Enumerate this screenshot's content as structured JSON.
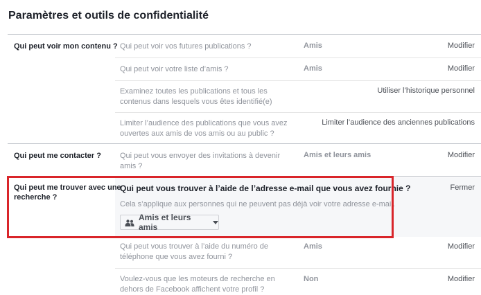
{
  "page_title": "Paramètres et outils de confidentialité",
  "sections": [
    {
      "label": "Qui peut voir mon contenu ?",
      "rows": [
        {
          "question": "Qui peut voir vos futures publications ?",
          "value": "Amis",
          "action": "Modifier"
        },
        {
          "question": "Qui peut voir votre liste d’amis ?",
          "value": "Amis",
          "action": "Modifier"
        },
        {
          "question_lines": [
            "Examinez toutes les publications et tous les",
            "contenus dans lesquels vous êtes identifié(e)"
          ],
          "value": "",
          "action": "Utiliser l’historique personnel"
        },
        {
          "question_lines": [
            "Limiter l’audience des publications que vous avez",
            "ouvertes aux amis de vos amis ou au public ?"
          ],
          "value": "",
          "action": "Limiter l’audience des anciennes publications"
        }
      ]
    },
    {
      "label": "Qui peut me contacter ?",
      "rows": [
        {
          "question_lines": [
            "Qui peut vous envoyer des invitations à devenir",
            "amis ?"
          ],
          "value": "Amis et leurs amis",
          "action": "Modifier"
        }
      ]
    },
    {
      "label_lines": [
        "Qui peut me trouver avec une",
        "recherche ?"
      ],
      "expanded": {
        "question": "Qui peut vous trouver à l’aide de l’adresse e-mail que vous avez fournie ?",
        "description": "Cela s’applique aux personnes qui ne peuvent pas déjà voir votre adresse e-mail.",
        "dropdown_value": "Amis et leurs amis",
        "dropdown_icon": "friends-icon",
        "close_label": "Fermer"
      },
      "rows": [
        {
          "question_lines": [
            "Qui peut vous trouver à l’aide du numéro de",
            "téléphone que vous avez fourni ?"
          ],
          "value": "Amis",
          "action": "Modifier"
        },
        {
          "question_lines": [
            "Voulez-vous que les moteurs de recherche en",
            "dehors de Facebook affichent votre profil ?"
          ],
          "value": "Non",
          "action": "Modifier"
        }
      ]
    }
  ],
  "colors": {
    "highlight": "#d9252a",
    "muted_text": "#90949c",
    "expanded_bg": "#f6f7f9"
  }
}
